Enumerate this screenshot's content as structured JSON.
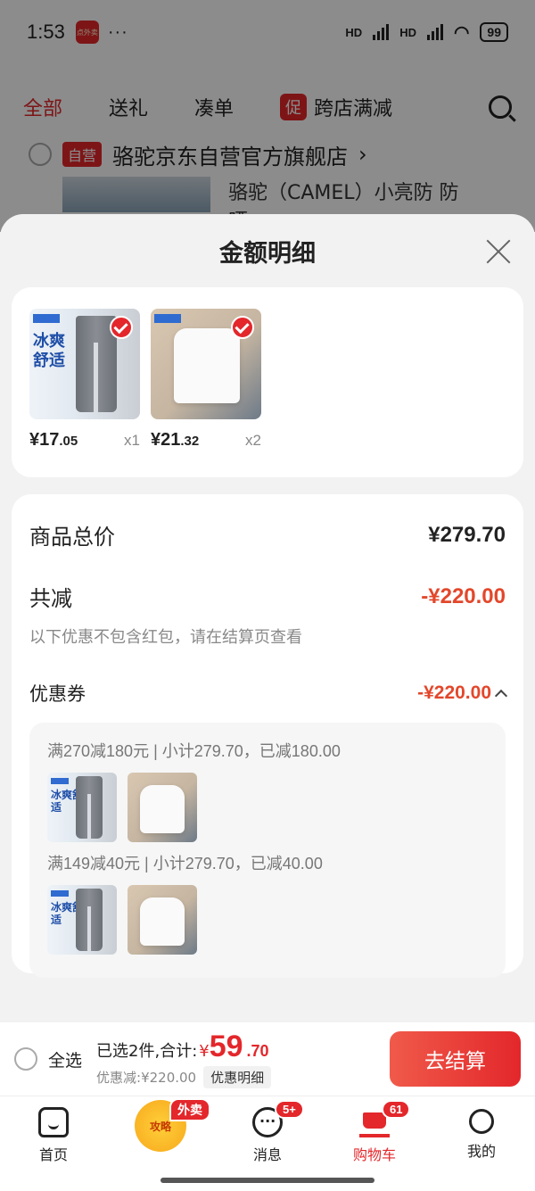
{
  "status_bar": {
    "time": "1:53",
    "app_badge": "点外卖",
    "dots": "···",
    "battery": "99",
    "net1": "HD",
    "net2": "HD"
  },
  "background": {
    "tabs": [
      "全部",
      "送礼",
      "凑单",
      "跨店满减"
    ],
    "promo_chip": "促",
    "store_tag": "自营",
    "store_name": "骆驼京东自营官方旗舰店",
    "store_chevron": "›",
    "product_title": "骆驼（CAMEL）小亮防 防晒"
  },
  "sheet": {
    "title": "金额明细",
    "products": [
      {
        "brand_text": "冰爽舒适",
        "price_int": "¥17",
        "price_dec": ".05",
        "qty": "x1"
      },
      {
        "brand_text": "",
        "price_int": "¥21",
        "price_dec": ".32",
        "qty": "x2"
      }
    ],
    "total_label": "商品总价",
    "total_value": "¥279.70",
    "discount_label": "共减",
    "discount_value": "-¥220.00",
    "discount_hint": "以下优惠不包含红包，请在结算页查看",
    "coupon_label": "优惠券",
    "coupon_value": "-¥220.00",
    "coupon_rules": [
      "满270减180元 | 小计279.70，已减180.00",
      "满149减40元 | 小计279.70，已减40.00"
    ],
    "mini_brand_text": "冰爽舒适"
  },
  "checkout": {
    "select_all": "全选",
    "selected_text": "已选2件,合计:",
    "currency": "¥",
    "total_int": "59",
    "total_dec": ".70",
    "saved_text": "优惠减:¥220.00",
    "detail_chip": "优惠明细",
    "button": "去结算"
  },
  "nav": {
    "home": "首页",
    "strategy": "攻略",
    "strategy_badge": "外卖",
    "messages": "消息",
    "messages_badge": "5+",
    "cart": "购物车",
    "cart_badge": "61",
    "me": "我的"
  },
  "colors": {
    "accent": "#e3272b",
    "discount": "#e3472b"
  }
}
